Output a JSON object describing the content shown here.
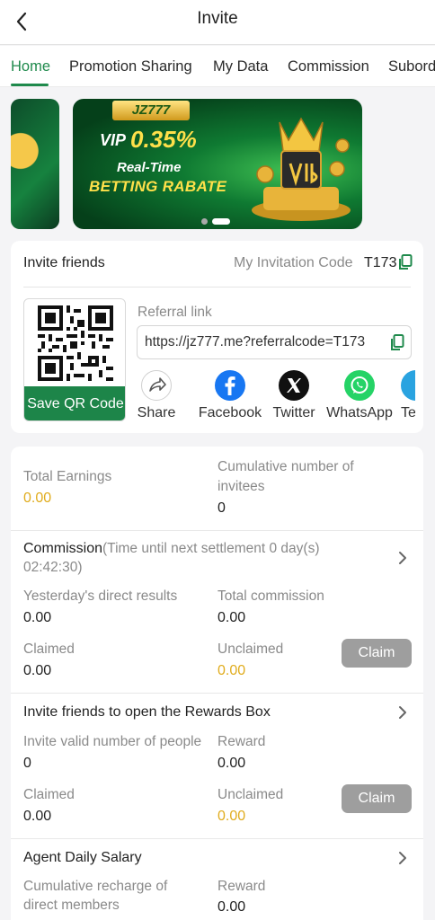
{
  "header": {
    "title": "Invite"
  },
  "tabs": [
    {
      "label": "Home"
    },
    {
      "label": "Promotion Sharing"
    },
    {
      "label": "My Data"
    },
    {
      "label": "Commission"
    },
    {
      "label": "Subord"
    }
  ],
  "banner": {
    "logo": "JZ777",
    "vip": "VIP",
    "rate": "0.35%",
    "line1": "Real-Time",
    "line2": "BETTING RABATE"
  },
  "invite": {
    "title": "Invite friends",
    "code_label": "My Invitation Code",
    "code_value": "T173",
    "save_qr": "Save QR Code",
    "referral_label": "Referral link",
    "referral_value": "https://jz777.me?referralcode=T173",
    "share_items": [
      {
        "label": "Share",
        "icon": "share-icon"
      },
      {
        "label": "Facebook",
        "icon": "facebook-icon"
      },
      {
        "label": "Twitter",
        "icon": "twitter-x-icon"
      },
      {
        "label": "WhatsApp",
        "icon": "whatsapp-icon"
      },
      {
        "label": "Tel",
        "icon": "telegram-icon"
      }
    ]
  },
  "earnings": {
    "total_label": "Total Earnings",
    "total_value": "0.00",
    "invitees_label_1": "Cumulative number of",
    "invitees_label_2": "invitees",
    "invitees_value": "0"
  },
  "commission": {
    "title": "Commission",
    "subtitle_1": "(Time until next settlement 0 day(s)",
    "subtitle_2": "02:42:30)",
    "yesterday_label": "Yesterday's direct results",
    "yesterday_value": "0.00",
    "total_label": "Total commission",
    "total_value": "0.00",
    "claimed_label": "Claimed",
    "claimed_value": "0.00",
    "unclaimed_label": "Unclaimed",
    "unclaimed_value": "0.00",
    "claim_button": "Claim"
  },
  "rewards_box": {
    "title": "Invite friends to open the Rewards Box",
    "valid_label": "Invite valid number of people",
    "valid_value": "0",
    "reward_label": "Reward",
    "reward_value": "0.00",
    "claimed_label": "Claimed",
    "claimed_value": "0.00",
    "unclaimed_label": "Unclaimed",
    "unclaimed_value": "0.00",
    "claim_button": "Claim"
  },
  "salary": {
    "title": "Agent Daily Salary",
    "recharge_label_1": "Cumulative recharge of",
    "recharge_label_2": "direct members",
    "reward_label": "Reward",
    "reward_value": "0.00"
  },
  "colors": {
    "accent": "#1f8a4c",
    "gold": "#e0ac1d",
    "claim_disabled": "#9e9e9e"
  }
}
